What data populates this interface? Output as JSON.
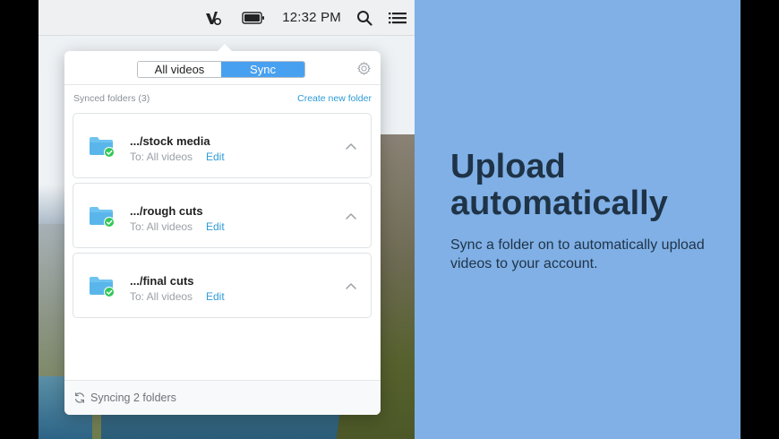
{
  "menubar": {
    "time": "12:32 PM",
    "icons": [
      "vimeo-sync-app-icon",
      "battery-icon",
      "search-icon",
      "list-icon"
    ]
  },
  "popover": {
    "tabs": [
      {
        "label": "All videos",
        "selected": false
      },
      {
        "label": "Sync",
        "selected": true
      }
    ],
    "settings_icon": "gear-icon",
    "synced_folders_label": "Synced folders (3)",
    "create_folder_label": "Create new folder",
    "folders": [
      {
        "name": ".../stock media",
        "destination": "To: All videos",
        "edit_label": "Edit"
      },
      {
        "name": ".../rough cuts",
        "destination": "To: All videos",
        "edit_label": "Edit"
      },
      {
        "name": ".../final cuts",
        "destination": "To: All videos",
        "edit_label": "Edit"
      }
    ],
    "footer_status": "Syncing 2 folders"
  },
  "promo": {
    "headline": "Upload automatically",
    "description": "Sync a folder on to automatically upload videos to your account."
  },
  "colors": {
    "accent": "#48a0f0",
    "link": "#2f9bd6",
    "panel_bg": "#80b0e6",
    "headline": "#1f3347",
    "success": "#34c759"
  }
}
